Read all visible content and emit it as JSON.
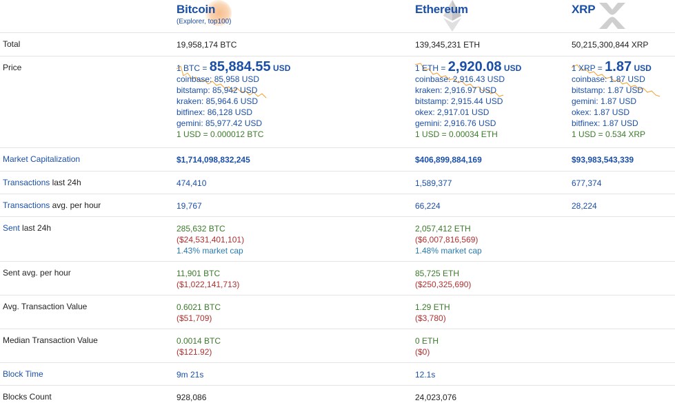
{
  "coins": [
    {
      "name": "Bitcoin",
      "sub": "(Explorer, top100)",
      "logo": "bitcoin-icon"
    },
    {
      "name": "Ethereum",
      "sub": "",
      "logo": "ethereum-icon"
    },
    {
      "name": "XRP",
      "sub": "",
      "logo": "xrp-icon"
    }
  ],
  "rows": {
    "total": {
      "label": "Total",
      "values": [
        "19,958,174 BTC",
        "139,345,231 ETH",
        "50,215,300,844 XRP"
      ]
    },
    "price": {
      "label": "Price",
      "btc": {
        "prefix": "1 BTC =",
        "value": "85,884.55",
        "unit": "USD",
        "exchanges": [
          "coinbase: 85,958 USD",
          "bitstamp: 85,942 USD",
          "kraken: 85,964.6 USD",
          "bitfinex: 86,128 USD",
          "gemini: 85,977.42 USD"
        ],
        "inverse": "1 USD = 0.000012 BTC"
      },
      "eth": {
        "prefix": "1 ETH =",
        "value": "2,920.08",
        "unit": "USD",
        "exchanges": [
          "coinbase: 2,916.43 USD",
          "kraken: 2,916.97 USD",
          "bitstamp: 2,915.44 USD",
          "okex: 2,917.01 USD",
          "gemini: 2,916.76 USD"
        ],
        "inverse": "1 USD = 0.00034 ETH"
      },
      "xrp": {
        "prefix": "1 XRP =",
        "value": "1.87",
        "unit": "USD",
        "exchanges": [
          "coinbase: 1.87 USD",
          "bitstamp: 1.87 USD",
          "gemini: 1.87 USD",
          "okex: 1.87 USD",
          "bitfinex: 1.87 USD"
        ],
        "inverse": "1 USD = 0.534 XRP"
      }
    },
    "market_cap": {
      "label": "Market Capitalization",
      "values": [
        "$1,714,098,832,245",
        "$406,899,884,169",
        "$93,983,543,339"
      ]
    },
    "tx_24h": {
      "label_link": "Transactions",
      "label_rest": " last 24h",
      "values": [
        "474,410",
        "1,589,377",
        "677,374"
      ]
    },
    "tx_hour": {
      "label_link": "Transactions",
      "label_rest": " avg. per hour",
      "values": [
        "19,767",
        "66,224",
        "28,224"
      ]
    },
    "sent_24h": {
      "label_link": "Sent",
      "label_rest": " last 24h",
      "btc": {
        "amount": "285,632 BTC",
        "usd": "($24,531,401,101)",
        "pct": "1.43% market cap"
      },
      "eth": {
        "amount": "2,057,412 ETH",
        "usd": "($6,007,816,569)",
        "pct": "1.48% market cap"
      }
    },
    "sent_hour": {
      "label": "Sent avg. per hour",
      "btc": {
        "amount": "11,901 BTC",
        "usd": "($1,022,141,713)"
      },
      "eth": {
        "amount": "85,725 ETH",
        "usd": "($250,325,690)"
      }
    },
    "avg_tx": {
      "label": "Avg. Transaction Value",
      "btc": {
        "amount": "0.6021 BTC",
        "usd": "($51,709)"
      },
      "eth": {
        "amount": "1.29 ETH",
        "usd": "($3,780)"
      }
    },
    "median_tx": {
      "label": "Median Transaction Value",
      "btc": {
        "amount": "0.0014 BTC",
        "usd": "($121.92)"
      },
      "eth": {
        "amount": "0 ETH",
        "usd": "($0)"
      }
    },
    "block_time": {
      "label": "Block Time",
      "values": [
        "9m 21s",
        "12.1s"
      ]
    },
    "blocks_count": {
      "label": "Blocks Count",
      "values": [
        "928,086",
        "24,023,076"
      ]
    }
  },
  "colors": {
    "link": "#1a4fa8",
    "green": "#3b7a2a",
    "red": "#b03030",
    "teal": "#2a7ab0",
    "spark": "#f0a030"
  }
}
